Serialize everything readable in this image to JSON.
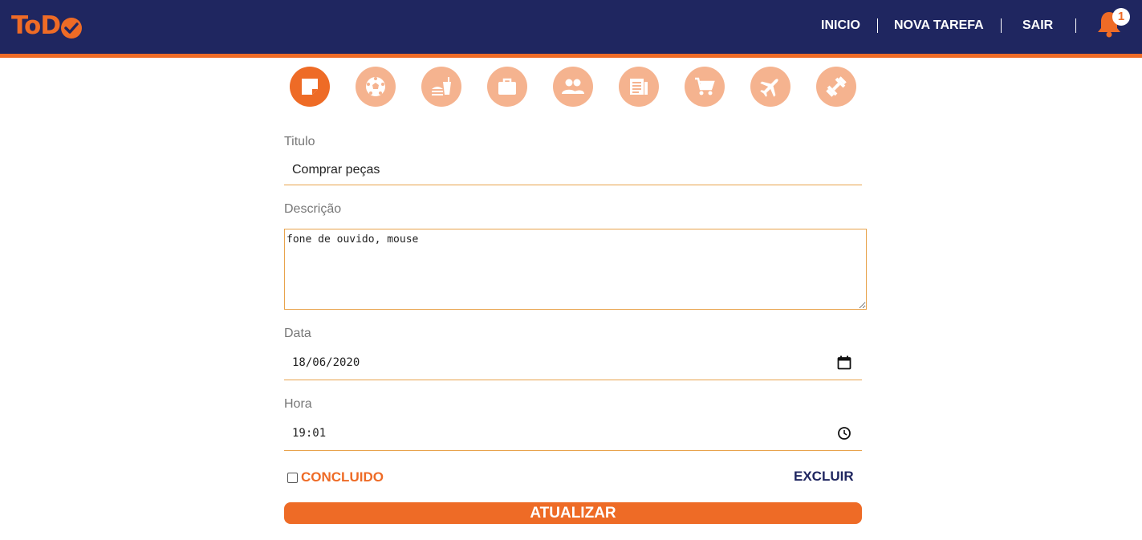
{
  "header": {
    "logo": "ToD",
    "nav": {
      "inicio": "INICIO",
      "nova_tarefa": "NOVA TAREFA",
      "sair": "SAIR"
    },
    "separator": "|",
    "notification_count": "1",
    "bell_icon": "bell-icon"
  },
  "task_types": [
    {
      "name": "note-icon",
      "selected": true
    },
    {
      "name": "soccer-ball-icon",
      "selected": false
    },
    {
      "name": "fastfood-icon",
      "selected": false
    },
    {
      "name": "briefcase-icon",
      "selected": false
    },
    {
      "name": "people-icon",
      "selected": false
    },
    {
      "name": "newspaper-icon",
      "selected": false
    },
    {
      "name": "shopping-cart-icon",
      "selected": false
    },
    {
      "name": "airplane-icon",
      "selected": false
    },
    {
      "name": "dumbbell-icon",
      "selected": false
    }
  ],
  "form": {
    "title_label": "Titulo",
    "title_value": "Comprar peças",
    "description_label": "Descrição",
    "description_value": "fone de ouvido, mouse",
    "date_label": "Data",
    "date_value": "18/06/2020",
    "time_label": "Hora",
    "time_value": "19:01",
    "concluido_label": "CONCLUIDO",
    "concluido_checked": false,
    "excluir_label": "EXCLUIR",
    "submit_label": "ATUALIZAR"
  },
  "colors": {
    "navy": "#1f2660",
    "orange": "#ee6b26",
    "orange_light": "#f5b38f"
  }
}
